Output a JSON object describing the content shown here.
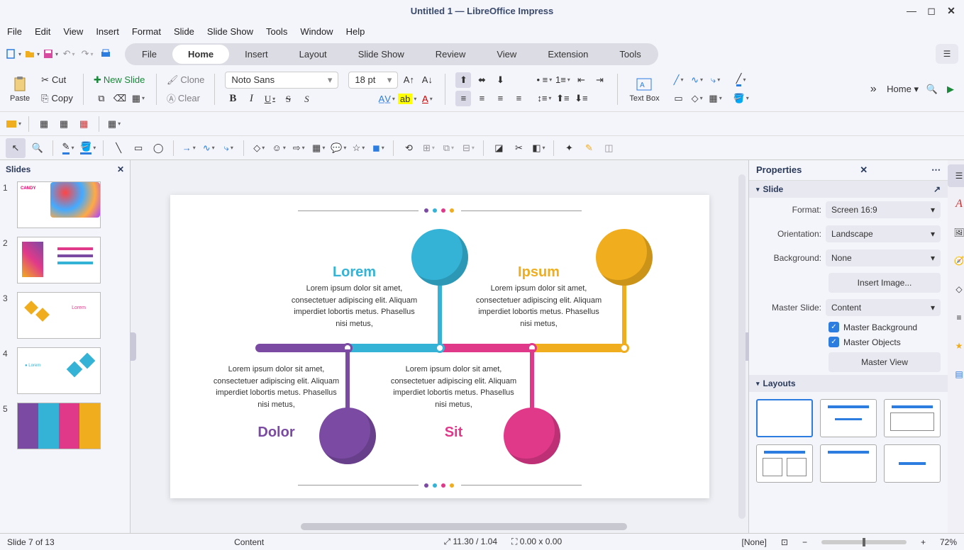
{
  "window": {
    "title": "Untitled 1 — LibreOffice Impress"
  },
  "menubar": [
    "File",
    "Edit",
    "View",
    "Insert",
    "Format",
    "Slide",
    "Slide Show",
    "Tools",
    "Window",
    "Help"
  ],
  "tabs": [
    "File",
    "Home",
    "Insert",
    "Layout",
    "Slide Show",
    "Review",
    "View",
    "Extension",
    "Tools"
  ],
  "active_tab": "Home",
  "toolbar": {
    "paste": "Paste",
    "cut": "Cut",
    "copy": "Copy",
    "new_slide": "New Slide",
    "clone": "Clone",
    "clear": "Clear",
    "font_name": "Noto Sans",
    "font_size": "18 pt",
    "text_box": "Text Box",
    "home_label": "Home"
  },
  "slides_panel": {
    "header": "Slides",
    "count": 5
  },
  "slide_content": {
    "titles": [
      "Lorem",
      "Ipsum",
      "Dolor",
      "Sit"
    ],
    "body": "Lorem ipsum dolor sit amet, consectetuer adipiscing elit. Aliquam imperdiet lobortis metus. Phasellus nisi metus,",
    "colors": {
      "purple": "#7b4aa3",
      "blue": "#34b3d6",
      "pink": "#e0398a",
      "orange": "#f0ad1e"
    }
  },
  "properties": {
    "header": "Properties",
    "slide_section": "Slide",
    "format_label": "Format:",
    "format_value": "Screen 16:9",
    "orientation_label": "Orientation:",
    "orientation_value": "Landscape",
    "background_label": "Background:",
    "background_value": "None",
    "insert_image": "Insert Image...",
    "master_slide_label": "Master Slide:",
    "master_slide_value": "Content",
    "master_background": "Master Background",
    "master_objects": "Master Objects",
    "master_view": "Master View",
    "layouts_section": "Layouts"
  },
  "status": {
    "slide_info": "Slide 7 of 13",
    "layout": "Content",
    "coords": "11.30 / 1.04",
    "size": "0.00 x 0.00",
    "sel": "[None]",
    "zoom": "72%"
  }
}
